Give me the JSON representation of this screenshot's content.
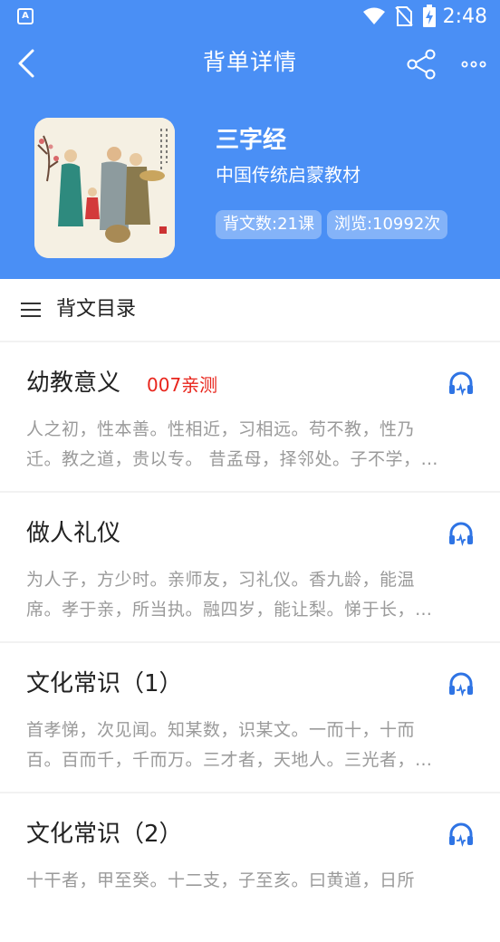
{
  "status": {
    "time": "2:48",
    "app_icon_letter": "A"
  },
  "nav": {
    "title": "背单详情"
  },
  "book": {
    "title": "三字经",
    "subtitle": "中国传统启蒙教材",
    "lesson_count": "背文数:21课",
    "views": "浏览:10992次"
  },
  "section": {
    "title": "背文目录"
  },
  "lessons": [
    {
      "title": "幼教意义",
      "badge": "007亲测",
      "line1": "人之初，性本善。性相近，习相远。苟不教，性乃",
      "line2": "迁。教之道，贵以专。 昔孟母，择邻处。子不学，…"
    },
    {
      "title": "做人礼仪",
      "badge": "",
      "line1": "为人子，方少时。亲师友，习礼仪。香九龄，能温",
      "line2": "席。孝于亲，所当执。融四岁，能让梨。悌于长，…"
    },
    {
      "title": "文化常识（1）",
      "badge": "",
      "line1": "首孝悌，次见闻。知某数，识某文。一而十，十而",
      "line2": "百。百而千，千而万。三才者，天地人。三光者，…"
    },
    {
      "title": "文化常识（2）",
      "badge": "",
      "line1": "十干者，甲至癸。十二支，子至亥。曰黄道，日所",
      "line2": ""
    }
  ],
  "colors": {
    "primary": "#4a8ff5",
    "badge_red": "#e8251c",
    "icon_blue": "#2f74e4"
  }
}
